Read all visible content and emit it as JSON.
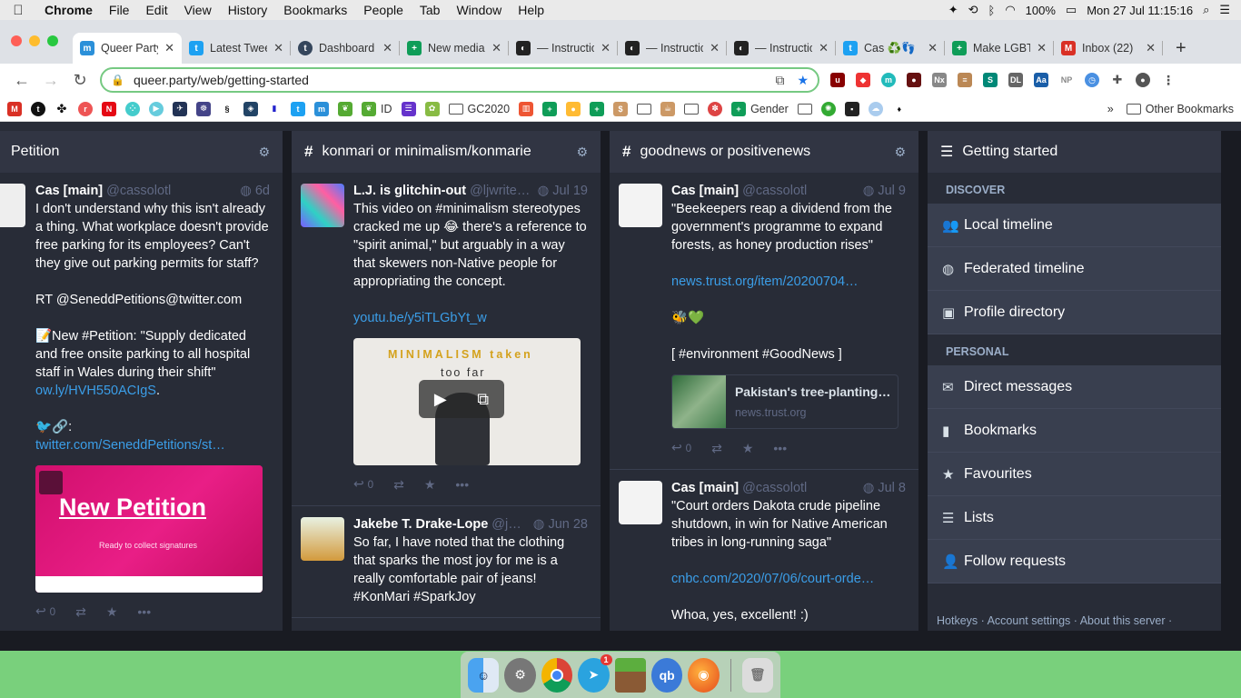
{
  "menubar": {
    "app": "Chrome",
    "menus": [
      "File",
      "Edit",
      "View",
      "History",
      "Bookmarks",
      "People",
      "Tab",
      "Window",
      "Help"
    ],
    "battery": "100%",
    "clock": "Mon 27 Jul  11:15:16"
  },
  "tabs": [
    {
      "title": "Queer Party",
      "color": "#2b90d9",
      "letter": "m"
    },
    {
      "title": "Latest Tweets",
      "color": "#1da1f2",
      "letter": "t"
    },
    {
      "title": "Dashboard",
      "color": "#35465c",
      "letter": "t"
    },
    {
      "title": "New media",
      "color": "#0f9d58",
      "letter": "+"
    },
    {
      "title": "— Instructions",
      "color": "#222",
      "letter": "◐"
    },
    {
      "title": "— Instructions",
      "color": "#222",
      "letter": "◐"
    },
    {
      "title": "— Instructions",
      "color": "#222",
      "letter": "◐"
    },
    {
      "title": "Cas ♻️👣",
      "color": "#1da1f2",
      "letter": "t"
    },
    {
      "title": "Make LGBT",
      "color": "#0f9d58",
      "letter": "+"
    },
    {
      "title": "Inbox (22)",
      "color": "#d93025",
      "letter": "M"
    }
  ],
  "toolbar": {
    "url": "queer.party/web/getting-started"
  },
  "bookmarks": {
    "items": [
      "ID",
      "GC2020",
      "Gender"
    ],
    "other": "Other Bookmarks"
  },
  "columns": [
    {
      "title": "Petition",
      "statuses": [
        {
          "name": "Cas [main]",
          "acct": "@cassolotl",
          "time": "6d",
          "text": "I don't understand why this isn't already a thing. What workplace doesn't provide free parking for its employees? Can't they give out parking permits for staff?\n\nRT @SeneddPetitions@twitter.com\n\n📝New #Petition: \"Supply dedicated and free onsite parking to all hospital staff in Wales during their shift\"",
          "link1": "ow.ly/HVH550ACIgS",
          "text2": "🐦🔗:",
          "link2": "twitter.com/SeneddPetitions/st…",
          "media_title": "New Petition",
          "media_sub": "Ready to collect signatures",
          "replies": "0"
        }
      ]
    },
    {
      "title": "konmari or minimalism/konmarie",
      "statuses": [
        {
          "name": "L.J. is glitchin-out",
          "acct": "@ljwrite…",
          "time": "Jul 19",
          "text": "This video on #minimalism stereotypes cracked me up 😂 there's a reference to \"spirit animal,\" but arguably in a way that skewers non-Native people for appropriating the concept.",
          "link1": "youtu.be/y5iTLGbYt_w",
          "media_title": "MINIMALISM taken",
          "media_sub": "too far",
          "replies": "0"
        },
        {
          "name": "Jakebe T. Drake-Lope",
          "acct": "@ja…",
          "time": "Jun 28",
          "text": "So far, I have noted that the clothing that sparks the most joy for me is a really comfortable pair of jeans! #KonMari #SparkJoy"
        }
      ]
    },
    {
      "title": "goodnews or positivenews",
      "statuses": [
        {
          "name": "Cas [main]",
          "acct": "@cassolotl",
          "time": "Jul 9",
          "text": "\"Beekeepers reap a dividend from the government's programme to expand forests, as honey production rises\"",
          "link1": "news.trust.org/item/20200704…",
          "text2": "🐝💚\n\n[ #environment #GoodNews ]",
          "card_title": "Pakistan's tree-planting p…",
          "card_url": "news.trust.org",
          "replies": "0"
        },
        {
          "name": "Cas [main]",
          "acct": "@cassolotl",
          "time": "Jul 8",
          "text": "\"Court orders Dakota crude pipeline shutdown, in win for Native American tribes in long-running saga\"",
          "link1": "cnbc.com/2020/07/06/court-orde…",
          "text2": "Whoa, yes, excellent! :)"
        }
      ]
    }
  ],
  "getting_started": {
    "title": "Getting started",
    "discover_label": "DISCOVER",
    "discover": [
      "Local timeline",
      "Federated timeline",
      "Profile directory"
    ],
    "personal_label": "PERSONAL",
    "personal": [
      "Direct messages",
      "Bookmarks",
      "Favourites",
      "Lists",
      "Follow requests"
    ],
    "footer": "Hotkeys · Account settings · About this server ·"
  },
  "dock": {
    "telegram_badge": "1"
  }
}
